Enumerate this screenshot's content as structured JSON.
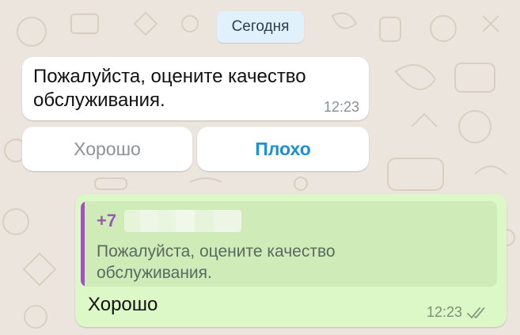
{
  "chat": {
    "date_label": "Сегодня",
    "incoming": {
      "text": "Пожалуйста, оцените качество обслуживания.",
      "time": "12:23"
    },
    "quick_replies": [
      {
        "label": "Хорошо"
      },
      {
        "label": "Плохо"
      }
    ],
    "outgoing": {
      "quote": {
        "sender_prefix": "+7",
        "text": "Пожалуйста, оцените качество обслуживания."
      },
      "text": "Хорошо",
      "time": "12:23",
      "status_icon": "double-check-icon"
    }
  },
  "colors": {
    "wallpaper": "#ece5dd",
    "incoming_bubble": "#ffffff",
    "outgoing_bubble": "#dcf8c6",
    "quote_accent": "#9b59b6",
    "link_blue": "#1d8ed8"
  }
}
